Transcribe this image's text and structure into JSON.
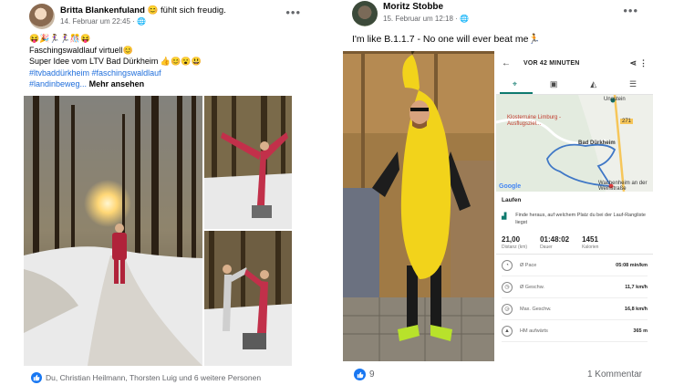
{
  "post_left": {
    "author": "Britta Blankenfuland",
    "feeling": "fühlt sich freudig.",
    "feeling_emoji": "😊",
    "date": "14. Februar um 22:45",
    "privacy_icon": "globe-icon",
    "more": "•••",
    "emoji_line": "😝🎉🏃‍♀️🏃‍♀️🎊😝",
    "line1": "Faschingswaldlauf virtuell😊",
    "line2": "Super Idee vom LTV Bad Dürkheim 👍😊😮😃",
    "hashtags1": "#ltvbaddürkheim #faschingswaldlauf",
    "hashtags2": "#landinbeweg...",
    "see_more": "Mehr ansehen",
    "reactions_text": "Du, Christian Heilmann, Thorsten Luig und 6 weitere Personen"
  },
  "post_right": {
    "author": "Moritz Stobbe",
    "date": "15. Februar um 12:18",
    "privacy_icon": "globe-icon",
    "more": "•••",
    "text": "I'm like B.1.1.7 - No one will ever beat me🏃",
    "likes": "9",
    "comments": "1 Kommentar"
  },
  "app": {
    "title": "VOR 42 MINUTEN",
    "map_labels": {
      "poi": "Klosterruine Limburg - Ausflugsziel...",
      "town": "Bad Dürkheim",
      "town2": "Wachenheim an der Weinstraße",
      "road": "271",
      "corner": "Ungstein",
      "google": "Google"
    },
    "activity": "Laufen",
    "hint": "Finde heraus, auf welchem Platz du bei der Lauf-Rangliste liegst",
    "stats": [
      {
        "value": "21,00",
        "label": "Distanz (km)"
      },
      {
        "value": "01:48:02",
        "label": "Dauer"
      },
      {
        "value": "1451",
        "label": "Kalorien"
      }
    ],
    "rows": [
      {
        "icon": "pace-icon",
        "label": "Ø Pace",
        "value": "05:08 min/km"
      },
      {
        "icon": "speed-icon",
        "label": "Ø Geschw.",
        "value": "11,7 km/h"
      },
      {
        "icon": "max-speed-icon",
        "label": "Max. Geschw.",
        "value": "16,8 km/h"
      },
      {
        "icon": "elevation-icon",
        "label": "HM aufwärts",
        "value": "365 m"
      }
    ]
  },
  "colors": {
    "link": "#216fdb",
    "like_blue": "#1877f2",
    "app_teal": "#0e7a6e",
    "banana": "#f2d31b"
  }
}
